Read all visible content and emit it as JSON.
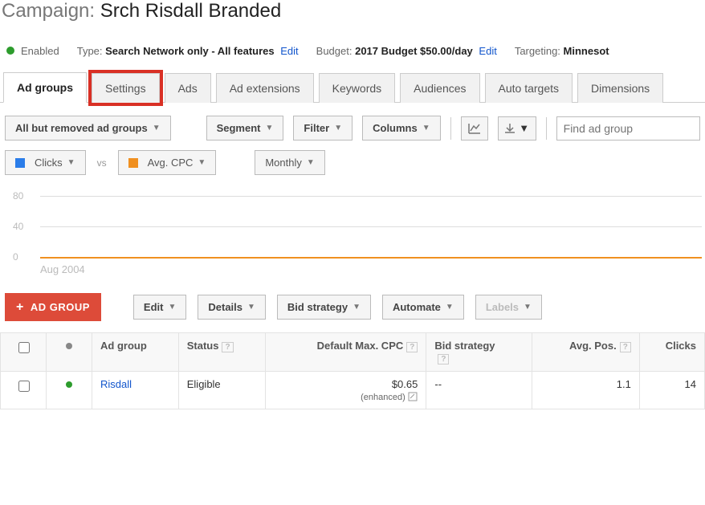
{
  "header": {
    "label": "Campaign: ",
    "value": "Srch Risdall Branded"
  },
  "status": {
    "label": "Enabled"
  },
  "info": {
    "type_label": "Type: ",
    "type_value": "Search Network only - All features",
    "budget_label": "Budget: ",
    "budget_value": "2017 Budget $50.00/day",
    "targeting_label": "Targeting: ",
    "targeting_value": "Minnesot",
    "edit": "Edit"
  },
  "tabs": {
    "adgroups": "Ad groups",
    "settings": "Settings",
    "ads": "Ads",
    "adext": "Ad extensions",
    "keywords": "Keywords",
    "audiences": "Audiences",
    "autotargets": "Auto targets",
    "dimensions": "Dimensions"
  },
  "toolbar": {
    "scope": "All but removed ad groups",
    "segment": "Segment",
    "filter": "Filter",
    "columns": "Columns",
    "search_placeholder": "Find ad group"
  },
  "metrics": {
    "a": "Clicks",
    "vs": "vs",
    "b": "Avg. CPC",
    "range": "Monthly"
  },
  "chart_data": {
    "type": "line",
    "categories": [
      "Aug 2004"
    ],
    "series": [
      {
        "name": "Clicks",
        "values": [
          0
        ]
      },
      {
        "name": "Avg. CPC",
        "values": [
          0
        ]
      }
    ],
    "ylim": [
      0,
      80
    ],
    "yticks": [
      0,
      40,
      80
    ],
    "xlabel": "Aug 2004"
  },
  "actions": {
    "add": "AD GROUP",
    "edit": "Edit",
    "details": "Details",
    "bidstrategy": "Bid strategy",
    "automate": "Automate",
    "labels": "Labels"
  },
  "table": {
    "headers": {
      "adgroup": "Ad group",
      "status": "Status",
      "defaultmax": "Default Max. CPC",
      "bidstrategy": "Bid strategy",
      "avgpos": "Avg. Pos.",
      "clicks": "Clicks"
    },
    "rows": [
      {
        "name": "Risdall",
        "status": "Eligible",
        "cpc": "$0.65",
        "cpc_note": "(enhanced)",
        "bidstrategy": "--",
        "avgpos": "1.1",
        "clicks": "14"
      }
    ]
  }
}
